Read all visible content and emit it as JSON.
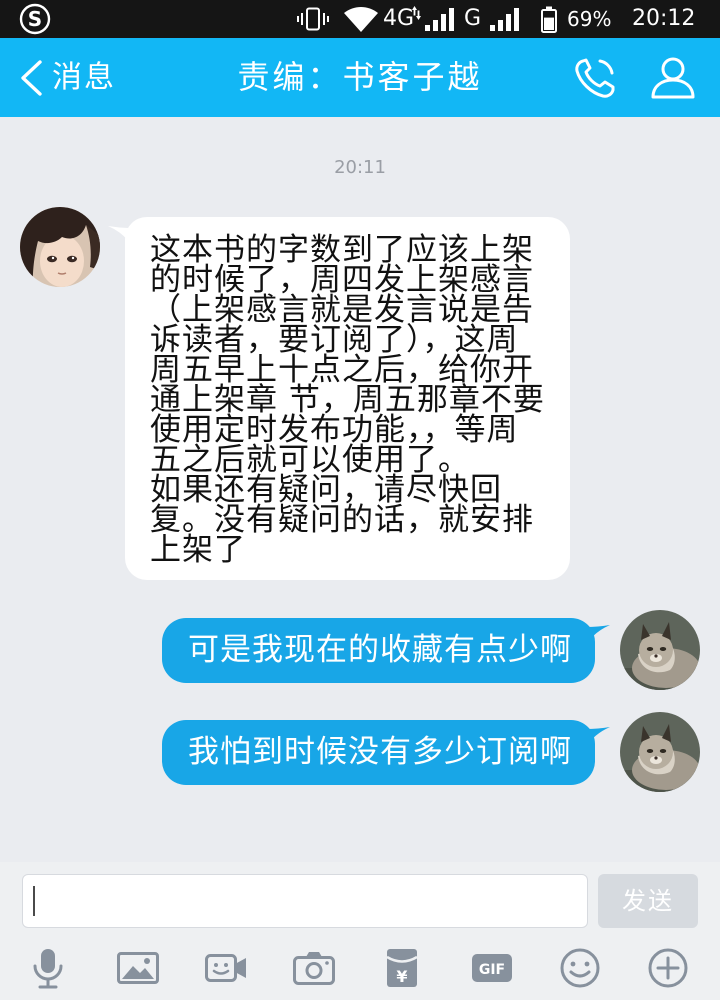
{
  "status_bar": {
    "app_badge_letter": "S",
    "network_primary": "4G",
    "network_secondary": "G",
    "battery_percent": "69%",
    "battery_level": 0.69,
    "time": "20:12",
    "icons": [
      "sogou-input-icon",
      "vibrate-icon",
      "wifi-icon",
      "data-arrows-icon",
      "signal-icon",
      "signal-icon",
      "battery-icon"
    ]
  },
  "header": {
    "back_label": "消息",
    "title": "责编：书客子越",
    "icons": [
      "chevron-left-icon",
      "phone-icon",
      "person-icon"
    ]
  },
  "chat": {
    "timestamp": "20:11",
    "received_message": {
      "lines": [
        "这本书的字数到了应该上架",
        "的时候了，周四发上架感言",
        "（上架感言就是发言说是告",
        "诉读者，要订阅了），这周",
        "周五早上十点之后，给你开",
        "通上架章 节，周五那章不要",
        "使用定时发布功能，，等周",
        "五之后就可以使用了。",
        "如果还有疑问，请尽快回",
        "复。没有疑问的话，就安排",
        "上架了"
      ]
    },
    "sent_messages": [
      "可是我现在的收藏有点少啊",
      "我怕到时候没有多少订阅啊"
    ]
  },
  "composer": {
    "send_label": "发送"
  },
  "toolbar": {
    "gif_label": "GIF",
    "red_packet_symbol": "¥",
    "icons": [
      "microphone-icon",
      "image-icon",
      "video-call-icon",
      "camera-icon",
      "red-packet-icon",
      "gif-icon",
      "emoji-icon",
      "plus-circle-icon"
    ]
  },
  "colors": {
    "status_bar": "#151515",
    "header": "#12B7F5",
    "chat_background": "#EAECF0",
    "received_bubble": "#FFFFFF",
    "sent_bubble": "#18A6E7",
    "send_button_disabled": "#D6DADF",
    "toolbar_icon": "#87919D"
  }
}
